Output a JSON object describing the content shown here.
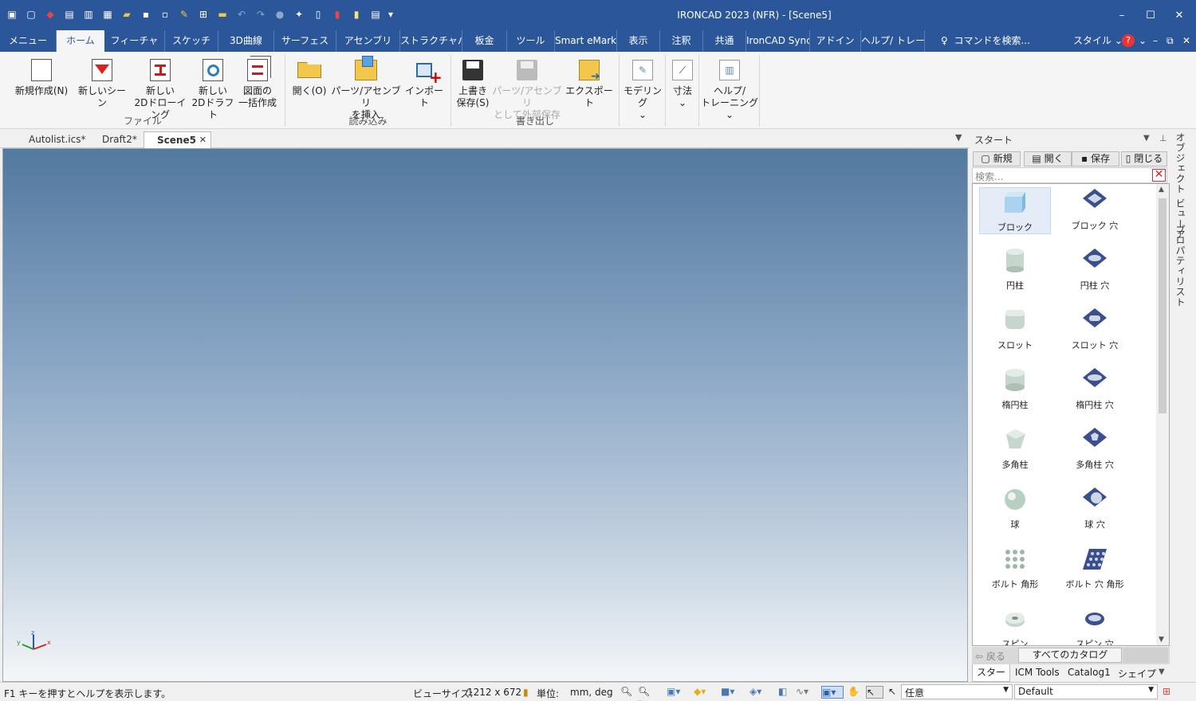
{
  "window": {
    "title": "IRONCAD 2023 (NFR) - [Scene5]",
    "minimize": "–",
    "maximize": "☐",
    "close": "✕"
  },
  "quick_access": [
    "app-icon",
    "new-icon",
    "scene-icon",
    "drawing-icon",
    "draft-icon",
    "catalog-icon",
    "open-icon",
    "save-icon",
    "saveall-icon",
    "tools-icon",
    "insert-icon",
    "folder-icon",
    "undo-icon",
    "redo-icon",
    "sphere-icon",
    "sparkle-icon",
    "part-icon",
    "red-icon",
    "blue-icon",
    "window-icon"
  ],
  "menubar": {
    "tabs": [
      "メニュー",
      "ホーム",
      "フィーチャ",
      "スケッチ",
      "3D曲線",
      "サーフェス",
      "アセンブリ",
      "ストラクチャパ",
      "板金",
      "ツール",
      "Smart eMarku",
      "表示",
      "注釈",
      "共通",
      "IronCAD Sync",
      "アドイン",
      "ヘルプ/ トレー"
    ],
    "active": "ホーム",
    "search_placeholder": "コマンドを検索...",
    "style": "スタイル",
    "help": "?"
  },
  "ribbon": {
    "groups": [
      {
        "label": "ファイル"
      },
      {
        "label": "読み込み"
      },
      {
        "label": "書き出し"
      }
    ],
    "buttons": {
      "new": [
        "新規作成(N)"
      ],
      "new_scene": [
        "新しいシーン"
      ],
      "new_2d_drawing": [
        "新しい",
        "2Dドローイング"
      ],
      "new_2d_draft": [
        "新しい",
        "2Dドラフト"
      ],
      "batch": [
        "図面の",
        "一括作成"
      ],
      "open": [
        "開く(O)"
      ],
      "insert_parts": [
        "パーツ/アセンブリ",
        "を挿入"
      ],
      "import": [
        "インポート"
      ],
      "save": [
        "上書き",
        "保存(S)"
      ],
      "save_parts": [
        "パーツ/アセンブリ",
        "として外部保存"
      ],
      "export": [
        "エクスポート"
      ],
      "modeling": [
        "モデリング",
        "⌄"
      ],
      "dimension": [
        "寸法",
        "⌄"
      ],
      "help": [
        "ヘルプ/",
        "トレーニング⌄"
      ]
    }
  },
  "doc_tabs": [
    {
      "label": "Autolist.ics*"
    },
    {
      "label": "Draft2*"
    },
    {
      "label": "Scene5",
      "active": true,
      "close": "✕"
    }
  ],
  "sidepanel": {
    "title": "スタート",
    "buttons": {
      "new": "新規",
      "open": "開く",
      "save": "保存",
      "close": "閉じる"
    },
    "search_placeholder": "検索...",
    "items": [
      "ブロック",
      "ブロック 穴",
      "円柱",
      "円柱 穴",
      "スロット",
      "スロット 穴",
      "楕円柱",
      "楕円柱 穴",
      "多角柱",
      "多角柱 穴",
      "球",
      "球 穴",
      "ボルト 角形",
      "ボルト 穴 角形",
      "スピン",
      "スピン 穴"
    ],
    "back": "戻る",
    "all_catalogs": "すべてのカタログ",
    "bottom_tabs": [
      "スタート",
      "ICM Tools",
      "Catalog1",
      "シェイプ"
    ]
  },
  "vertical_tabs": [
    "オブジェクト ビューア",
    "プロパティリスト"
  ],
  "status": {
    "help_text": "F1 キーを押すとヘルプを表示します。",
    "view_size_label": "ビューサイズ:",
    "view_size_value": "1212 x  672",
    "unit_label": "単位:",
    "unit_value": "mm, deg",
    "mode": "任意",
    "style": "Default"
  },
  "colors": {
    "accent": "#2b579a",
    "viewport_top": "#52799f",
    "viewport_bottom": "#f4f6f9"
  }
}
